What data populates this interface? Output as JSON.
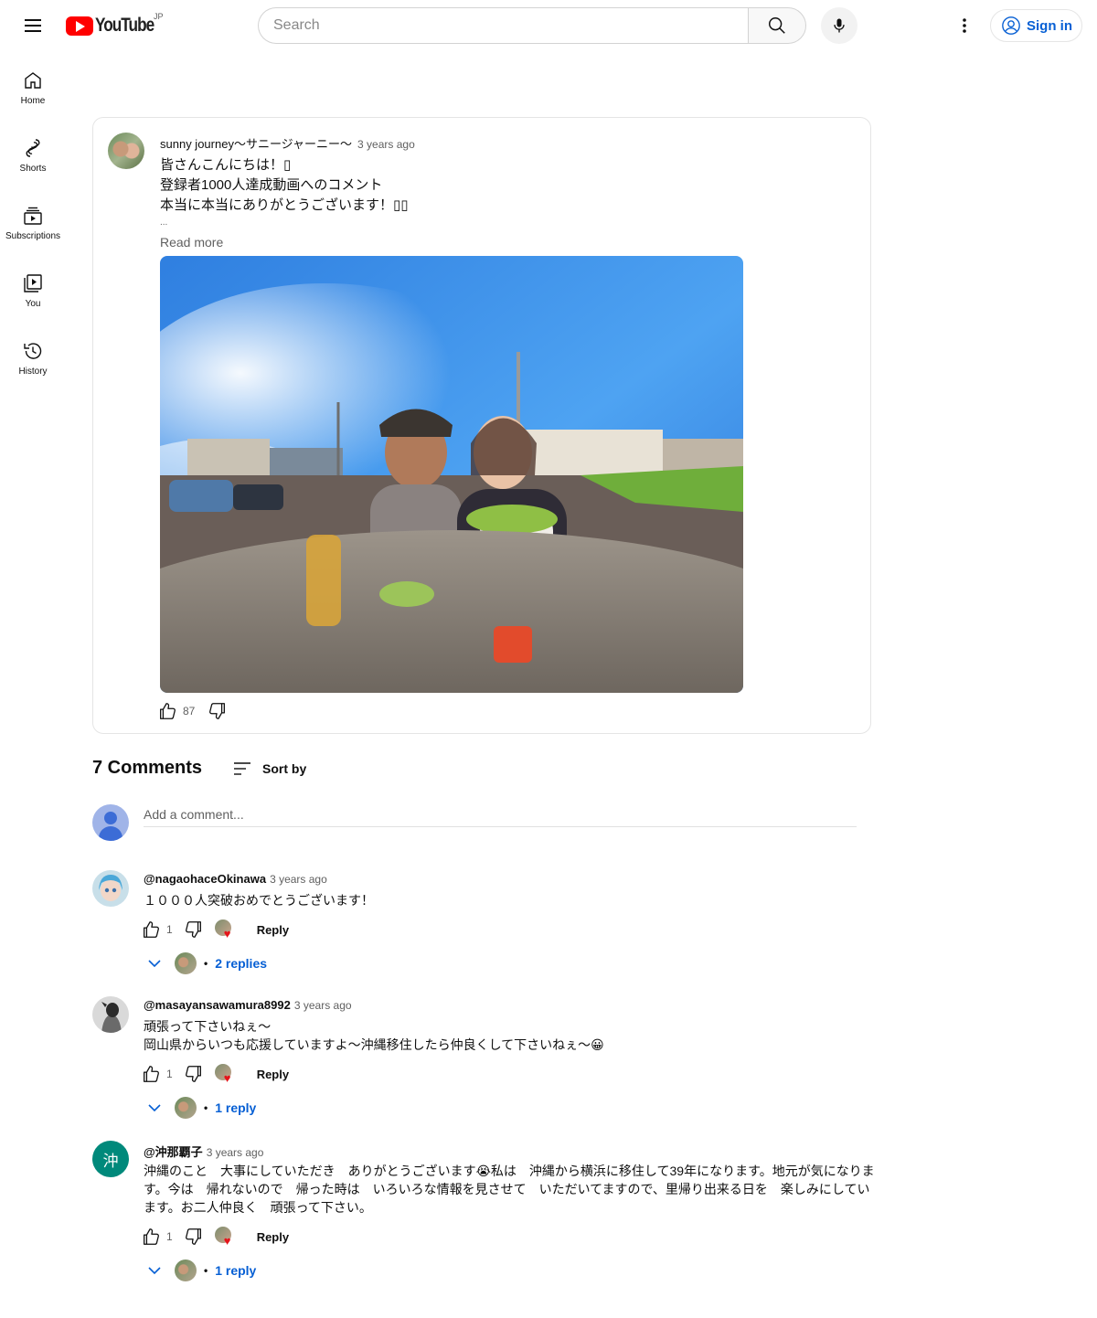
{
  "header": {
    "logo_text": "YouTube",
    "region": "JP",
    "search_placeholder": "Search",
    "signin_label": "Sign in"
  },
  "nav": {
    "items": [
      {
        "label": "Home",
        "icon": "home-icon"
      },
      {
        "label": "Shorts",
        "icon": "shorts-icon"
      },
      {
        "label": "Subscriptions",
        "icon": "subscriptions-icon"
      },
      {
        "label": "You",
        "icon": "library-icon"
      },
      {
        "label": "History",
        "icon": "history-icon"
      }
    ]
  },
  "post": {
    "author": "sunny journey〜サニージャーニー〜",
    "time": "3 years ago",
    "lines": [
      "皆さんこんにちは！▯",
      "登録者1000人達成動画へのコメント",
      "本当に本当にありがとうございます！▯▯"
    ],
    "ellipsis": "...",
    "read_more": "Read more",
    "likes": "87"
  },
  "comments": {
    "count_label": "7 Comments",
    "sort_label": "Sort by",
    "add_placeholder": "Add a comment...",
    "items": [
      {
        "author": "@nagaohaceOkinawa",
        "time": "3 years ago",
        "text": "１０００人突破おめでとうございます！",
        "likes": "1",
        "reply_label": "Reply",
        "replies_label": "2 replies"
      },
      {
        "author": "@masayansawamura8992",
        "time": "3 years ago",
        "text_lines": [
          "頑張って下さいねぇ〜",
          "岡山県からいつも応援していますよ〜沖縄移住したら仲良くして下さいねぇ〜😀"
        ],
        "likes": "1",
        "reply_label": "Reply",
        "replies_label": "1 reply"
      },
      {
        "author": "@沖那覇子",
        "time": "3 years ago",
        "avatar_letter": "沖",
        "avatar_color": "#00897b",
        "text": "沖縄のこと　大事にしていただき　ありがとうございます😭私は　沖縄から横浜に移住して39年になります。地元が気になります。今は　帰れないので　帰った時は　いろいろな情報を見させて　いただいてますので、里帰り出来る日を　楽しみにしています。お二人仲良く　頑張って下さい。",
        "likes": "1",
        "reply_label": "Reply",
        "replies_label": "1 reply"
      }
    ]
  },
  "colors": {
    "brand_red": "#ff0000",
    "link_blue": "#065fd4",
    "heart_red": "#e5141a"
  }
}
